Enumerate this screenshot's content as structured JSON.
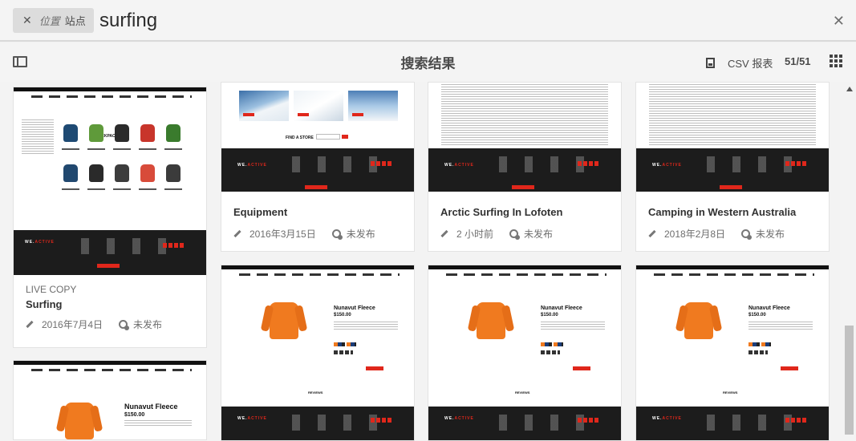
{
  "search": {
    "scope_prefix": "位置",
    "scope_label": "站点",
    "query": "surfing",
    "clear_icon": "x-icon",
    "close_icon": "close-icon"
  },
  "actionbar": {
    "title": "搜索结果",
    "csv_label": "CSV 报表",
    "count": "51/51",
    "rail_icon": "rail-toggle-icon",
    "view_icon": "card-view-icon"
  },
  "mock": {
    "backpacks_heading": "BACKPACKS",
    "brand_prefix": "WE.",
    "brand_suffix": "ACTIVE",
    "find_store": "FIND A STORE",
    "product_name": "Nunavut Fleece",
    "product_price": "$150.00",
    "reviews": "REVIEWS",
    "bag_colors": [
      "#1e4a73",
      "#5f9a3a",
      "#2b2b2b",
      "#c8352b",
      "#3a7b2d",
      "#21486f",
      "#2a2a2a",
      "#3c3c3c",
      "#d84b3a",
      "#3b3b3b"
    ]
  },
  "cards": [
    {
      "kicker": "LIVE COPY",
      "title": "Surfing",
      "date": "2016年7月4日",
      "status": "未发布"
    },
    {
      "kicker": "",
      "title": "",
      "date": "",
      "status": ""
    },
    {
      "kicker": "",
      "title": "Equipment",
      "date": "2016年3月15日",
      "status": "未发布"
    },
    {
      "kicker": "",
      "title": "",
      "date": "",
      "status": ""
    },
    {
      "kicker": "",
      "title": "Arctic Surfing In Lofoten",
      "date": "2 小时前",
      "status": "未发布"
    },
    {
      "kicker": "",
      "title": "",
      "date": "",
      "status": ""
    },
    {
      "kicker": "",
      "title": "Camping in Western Australia",
      "date": "2018年2月8日",
      "status": "未发布"
    },
    {
      "kicker": "",
      "title": "",
      "date": "",
      "status": ""
    }
  ]
}
